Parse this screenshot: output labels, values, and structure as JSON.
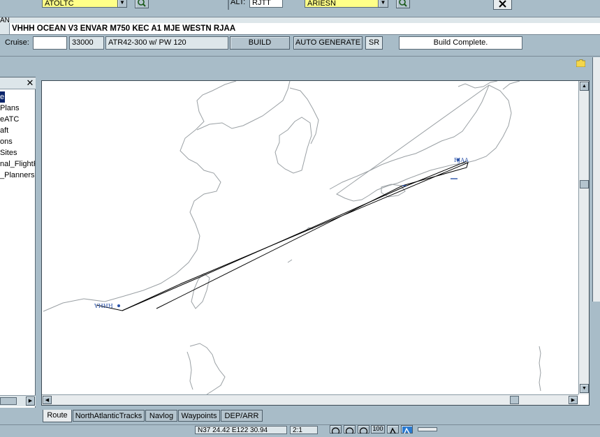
{
  "topbar": {
    "dep_combo_value": "ATOLTC",
    "alt_label": "ALT:",
    "alt_value": "RJTT",
    "alt_combo_value": "ARIESN"
  },
  "route": {
    "label": "AN",
    "string": "VHHH OCEAN V3 ENVAR M750 KEC A1 MJE WESTN RJAA"
  },
  "toolbar": {
    "cruise_label": "Cruise:",
    "cruise_value": "",
    "altitude_value": "33000",
    "aircraft_value": "ATR42-300 w/ PW 120",
    "build_label": "BUILD",
    "auto_generate_label": "AUTO GENERATE",
    "sr_label": "SR",
    "status_text": "Build Complete."
  },
  "sidebar": {
    "items": [
      "e",
      "Plans",
      "eATC",
      "aft",
      "ons",
      "Sites",
      "nal_FlightF",
      "_Planners"
    ]
  },
  "map": {
    "dep_label": "VHHH",
    "arr_label": "RJAA"
  },
  "tabs": [
    "Route",
    "NorthAtlanticTracks",
    "Navlog",
    "Waypoints",
    "DEP/ARR"
  ],
  "statusbar": {
    "coords": "N37 24.42  E122 30.94",
    "zoom": "2:1",
    "zoom_100": "100"
  },
  "colors": {
    "background": "#a8bcc8",
    "route_bar": "#dde6ea",
    "selected_item": "#0a246a",
    "map_bg": "#ffffff",
    "coast": "#9aa0a4",
    "airport_label": "#2a52a8"
  }
}
